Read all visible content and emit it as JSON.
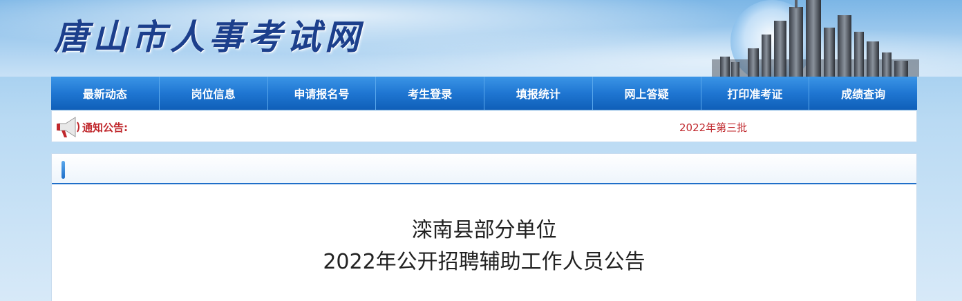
{
  "header": {
    "site_title": "唐山市人事考试网"
  },
  "nav": {
    "items": [
      "最新动态",
      "岗位信息",
      "申请报名号",
      "考生登录",
      "填报统计",
      "网上答疑",
      "打印准考证",
      "成绩查询"
    ]
  },
  "notice": {
    "label": "通知公告:",
    "ticker_text": "2022年第三批"
  },
  "article": {
    "title_line1": "滦南县部分单位",
    "title_line2": "2022年公开招聘辅助工作人员公告"
  },
  "colors": {
    "nav_bg": "#1f76d2",
    "notice_text": "#c0282d",
    "title_text": "#1c3f8c"
  }
}
